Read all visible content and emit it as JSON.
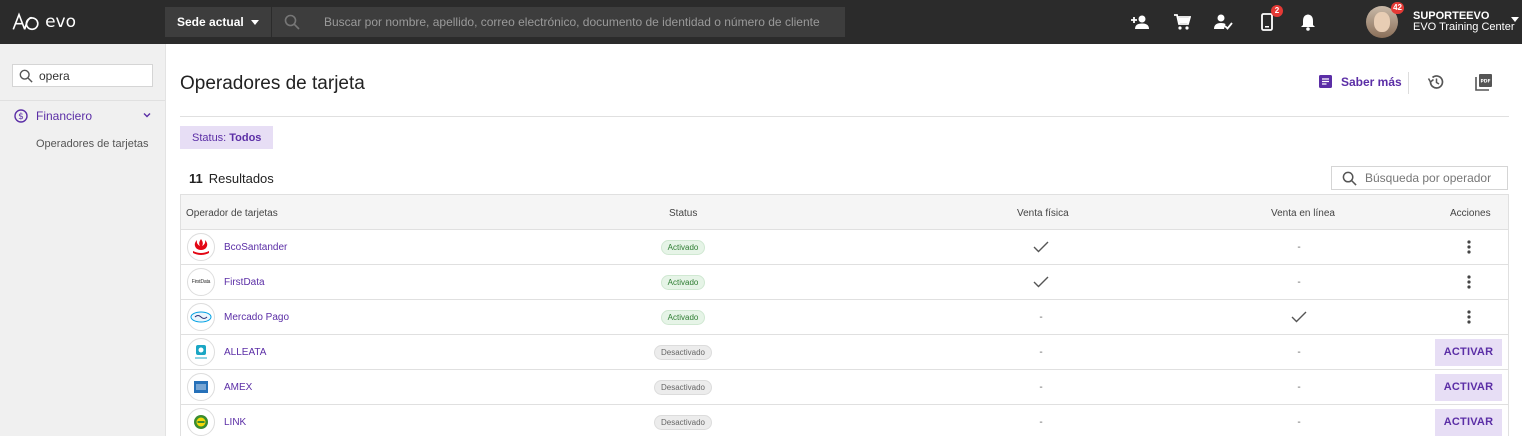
{
  "app": {
    "logo_text": "evo"
  },
  "topbar": {
    "sede_label": "Sede actual",
    "search_placeholder": "Buscar por nombre, apellido, correo electrónico, documento de identidad o número de cliente",
    "icons": [
      "add-person-icon",
      "cart-icon",
      "person-check-icon",
      "device-icon",
      "bell-icon"
    ],
    "device_badge": "2",
    "avatar_badge": "42",
    "user_name": "SUPORTEEVO",
    "user_org": "EVO Training Center"
  },
  "sidebar": {
    "search_value": "opera",
    "section_label": "Financiero",
    "sub_item": "Operadores de tarjetas"
  },
  "main": {
    "title": "Operadores de tarjeta",
    "saber_mas": "Saber más",
    "status_label": "Status:",
    "status_value": "Todos",
    "results_count": "11",
    "results_label": "Resultados",
    "operator_search_placeholder": "Búsqueda por operador"
  },
  "table": {
    "headers": {
      "operator": "Operador de tarjetas",
      "status": "Status",
      "venta_fisica": "Venta física",
      "venta_linea": "Venta en línea",
      "acciones": "Acciones"
    },
    "rows": [
      {
        "name": "BcoSantander",
        "status": "Activado",
        "active": true,
        "fisica": true,
        "linea": false,
        "logo": "santander"
      },
      {
        "name": "FirstData",
        "status": "Activado",
        "active": true,
        "fisica": true,
        "linea": false,
        "logo": "firstdata",
        "logo_text": "FirstData"
      },
      {
        "name": "Mercado Pago",
        "status": "Activado",
        "active": true,
        "fisica": false,
        "linea": true,
        "logo": "mercadopago"
      },
      {
        "name": "ALLEATA",
        "status": "Desactivado",
        "active": false,
        "fisica": false,
        "linea": false,
        "logo": "alleata"
      },
      {
        "name": "AMEX",
        "status": "Desactivado",
        "active": false,
        "fisica": false,
        "linea": false,
        "logo": "amex"
      },
      {
        "name": "LINK",
        "status": "Desactivado",
        "active": false,
        "fisica": false,
        "linea": false,
        "logo": "link"
      }
    ],
    "dash": "-",
    "activar_label": "ACTIVAR"
  },
  "colors": {
    "accent": "#5b2ea6",
    "topbar": "#2b2b2b",
    "sidebar": "#f0f0f0",
    "santander": "#e30613"
  }
}
